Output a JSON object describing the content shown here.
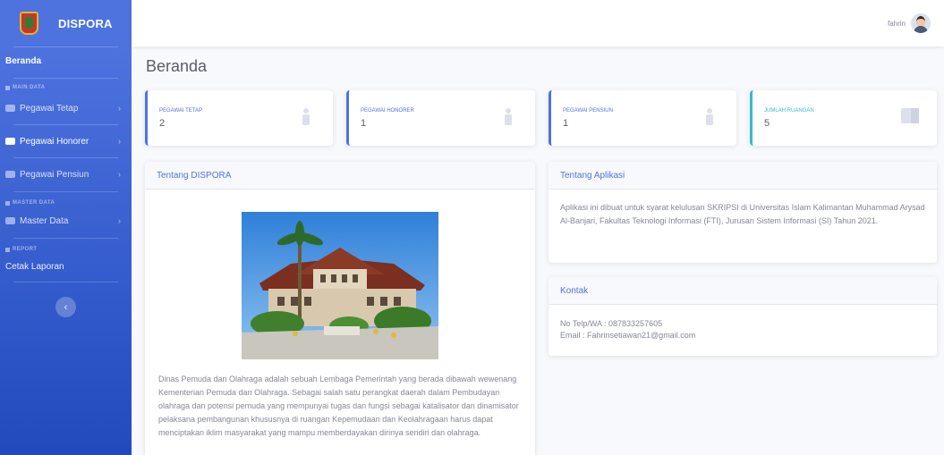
{
  "brand": {
    "name": "DISPORA"
  },
  "sidebar": {
    "home": "Beranda",
    "sections": [
      {
        "heading": "MAIN DATA"
      },
      {
        "heading": "MASTER DATA"
      },
      {
        "heading": "REPORT"
      }
    ],
    "items": [
      {
        "label": "Pegawai Tetap",
        "icon": "users-icon"
      },
      {
        "label": "Pegawai Honorer",
        "icon": "users-icon"
      },
      {
        "label": "Pegawai Pensiun",
        "icon": "users-icon"
      },
      {
        "label": "Master Data",
        "icon": "table-icon"
      },
      {
        "label": "Cetak Laporan"
      }
    ],
    "toggle_symbol": "‹"
  },
  "topbar": {
    "username": "fahrin"
  },
  "page": {
    "title": "Beranda"
  },
  "stats": [
    {
      "label": "PEGAWAI TETAP",
      "value": "2",
      "icon": "user-icon"
    },
    {
      "label": "PEGAWAI HONORER",
      "value": "1",
      "icon": "user-icon"
    },
    {
      "label": "PEGAWAI PENSIUN",
      "value": "1",
      "icon": "user-icon"
    },
    {
      "label": "JUMLAH RUANGAN",
      "value": "5",
      "icon": "door-icon"
    }
  ],
  "about_dispora": {
    "title": "Tentang DISPORA",
    "text": "Dinas Pemuda dan Olahraga adalah sebuah Lembaga Pemerintah yang berada dibawah wewenang Kementerian Pemuda dan Olahraga. Sebagai salah satu perangkat daerah dalam Pembudayan olahraga dan potensi pemuda yang mempunyai tugas dan fungsi sebagai katalisator dan dinamisator pelaksana pembangunan khususnya di ruangan Kepemudaan dan Keolahragaan harus dapat menciptakan iklim masyarakat yang mampu memberdayakan dirinya sendiri dan olahraga."
  },
  "about_app": {
    "title": "Tentang Aplikasi",
    "text": "Aplikasi ini dibuat untuk syarat kelulusan SKRIPSI di Universitas Islam Kalimantan Muhammad Arysad Al-Banjari, Fakultas Teknologi Informasi (FTI), Jurusan Sistem Informasi (SI) Tahun 2021."
  },
  "contact": {
    "title": "Kontak",
    "phone": "No Telp/WA : 087833257605",
    "email": "Email : Fahrinsetiawan21@gmail.com"
  },
  "colors": {
    "primary": "#4e73df",
    "info": "#36b9cc",
    "sidebar_bottom": "#224abe"
  }
}
